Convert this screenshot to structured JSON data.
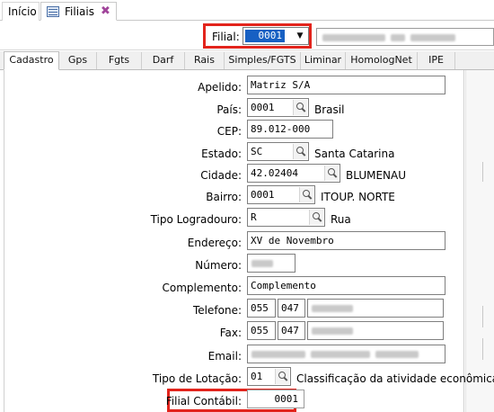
{
  "doc_tabs": {
    "inicio": "Início",
    "filiais": "Filiais",
    "close": "✖"
  },
  "toolbar": {
    "filial_label": "Filial:",
    "filial_value": "0001",
    "combo_arrow": "▼"
  },
  "record_tabs": [
    "Cadastro",
    "Gps",
    "Fgts",
    "Darf",
    "Rais",
    "Simples/FGTS",
    "Liminar",
    "HomologNet",
    "IPE"
  ],
  "form": {
    "apelido": {
      "label": "Apelido:",
      "value": "Matriz S/A"
    },
    "pais": {
      "label": "País:",
      "value": "0001",
      "desc": "Brasil"
    },
    "cep": {
      "label": "CEP:",
      "value": "89.012-000"
    },
    "estado": {
      "label": "Estado:",
      "value": "SC",
      "desc": "Santa Catarina"
    },
    "cidade": {
      "label": "Cidade:",
      "value": "42.02404",
      "desc": "BLUMENAU"
    },
    "bairro": {
      "label": "Bairro:",
      "value": "0001",
      "desc": "ITOUP. NORTE"
    },
    "tipo_logradouro": {
      "label": "Tipo Logradouro:",
      "value": "R",
      "desc": "Rua"
    },
    "endereco": {
      "label": "Endereço:",
      "value": "XV de Novembro"
    },
    "numero": {
      "label": "Número:"
    },
    "complemento": {
      "label": "Complemento:",
      "value": "Complemento"
    },
    "telefone": {
      "label": "Telefone:",
      "ddi": "055",
      "ddd": "047"
    },
    "fax": {
      "label": "Fax:",
      "ddi": "055",
      "ddd": "047"
    },
    "email": {
      "label": "Email:"
    },
    "tipo_lotacao": {
      "label": "Tipo de Lotação:",
      "value": "01",
      "desc": "Classificação da atividade econômica"
    },
    "filial_contabil": {
      "label": "Filial Contábil:",
      "value": "0001"
    }
  },
  "colors": {
    "highlight_border": "#e2241c",
    "selection": "#1760c3",
    "close_icon": "#a0449a"
  }
}
